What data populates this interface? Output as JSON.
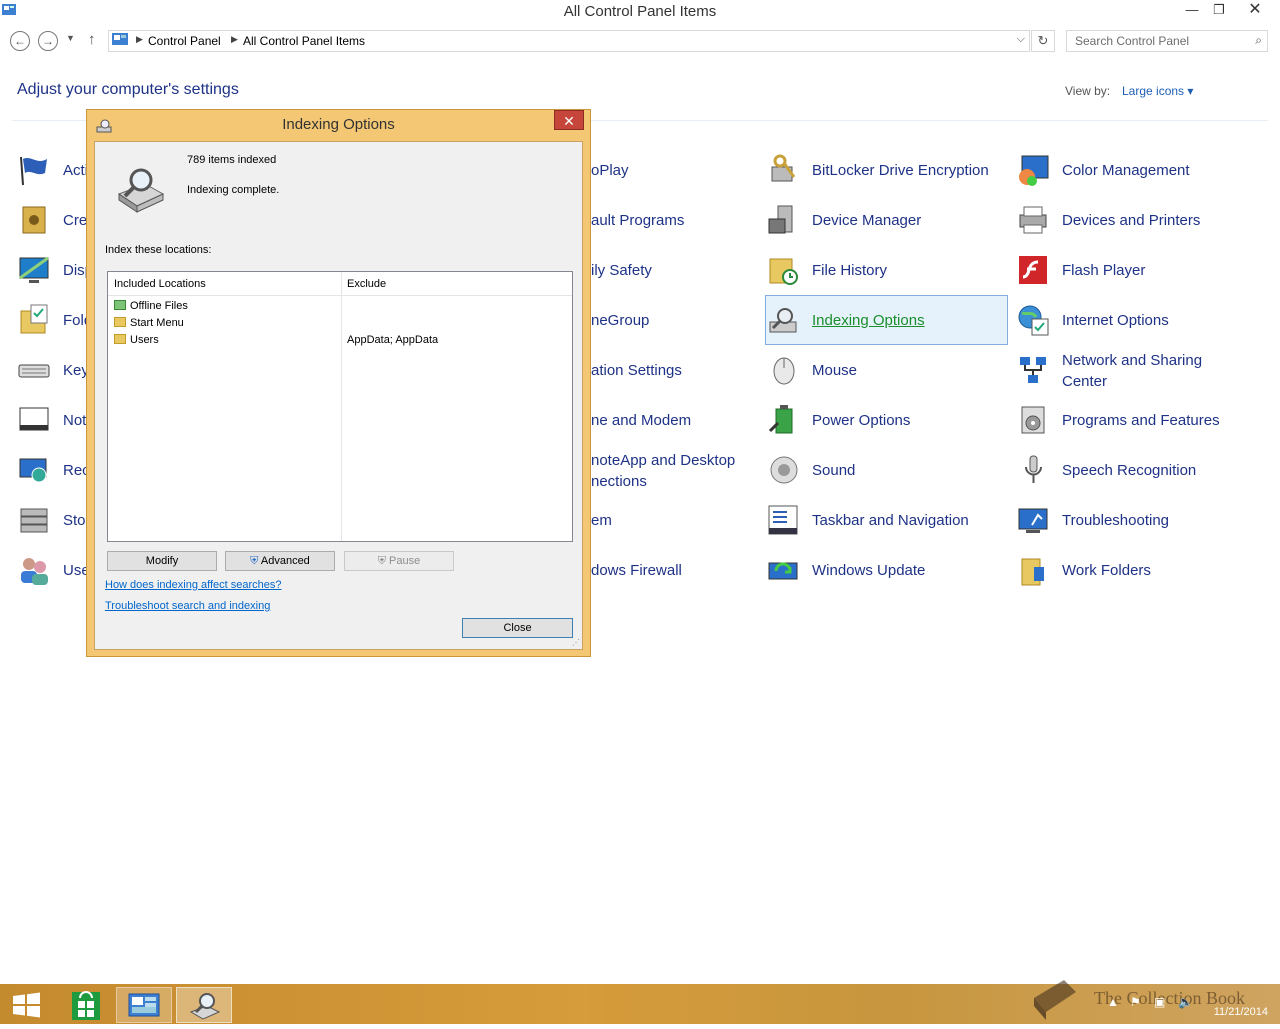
{
  "window": {
    "title": "All Control Panel Items",
    "minimize": "—",
    "maximize": "❐",
    "close": "✕"
  },
  "address": {
    "crumbs": [
      "Control Panel",
      "All Control Panel Items"
    ],
    "search_placeholder": "Search Control Panel"
  },
  "header": {
    "title": "Adjust your computer's settings",
    "view_by_label": "View by:",
    "view_by_value": "Large icons ▾"
  },
  "items": {
    "col1": [
      "Acti",
      "Cre",
      "Disp",
      "Fold",
      "Key",
      "Not",
      "Rec",
      "Sto",
      "Use"
    ],
    "col2": [
      "oPlay",
      "ault Programs",
      "ily Safety",
      "neGroup",
      "ation Settings",
      "ne and Modem",
      "noteApp and Desktop",
      "nections",
      "em",
      "dows Firewall"
    ],
    "col3": [
      "BitLocker Drive Encryption",
      "Device Manager",
      "File History",
      "Indexing Options",
      "Mouse",
      "Power Options",
      "Sound",
      "Taskbar and Navigation",
      "Windows Update"
    ],
    "col4": [
      "Color Management",
      "Devices and Printers",
      "Flash Player",
      "Internet Options",
      "Network and Sharing",
      "Center",
      "Programs and Features",
      "Speech Recognition",
      "Troubleshooting",
      "Work Folders"
    ]
  },
  "dialog": {
    "title": "Indexing Options",
    "close": "✕",
    "items_indexed": "789 items indexed",
    "status": "Indexing complete.",
    "locations_label": "Index these locations:",
    "col_included": "Included Locations",
    "col_exclude": "Exclude",
    "rows": [
      {
        "name": "Offline Files",
        "exclude": ""
      },
      {
        "name": "Start Menu",
        "exclude": ""
      },
      {
        "name": "Users",
        "exclude": "AppData; AppData"
      }
    ],
    "btn_modify": "Modify",
    "btn_advanced": "Advanced",
    "btn_pause": "Pause",
    "link_how": "How does indexing affect searches?",
    "link_troubleshoot": "Troubleshoot search and indexing",
    "btn_close": "Close"
  },
  "taskbar": {
    "date": "11/21/2014",
    "watermark": "The Collection Book"
  },
  "colors": {
    "link": "#1e3287",
    "dialog_frame": "#f3c774",
    "selected_link": "#1a8f2c"
  }
}
